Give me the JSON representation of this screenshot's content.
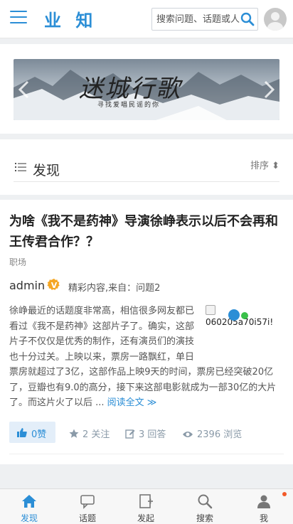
{
  "header": {
    "logo": "业 知",
    "search_placeholder": "搜索问题、话题或人"
  },
  "banner": {
    "title": "迷城行歌",
    "subtitle": "寻找爱唱民谣的你"
  },
  "section": {
    "title": "发现",
    "sort_label": "排序 ⬍"
  },
  "question": {
    "title": "为啥《我不是药神》导演徐峥表示以后不会再和王传君合作？？",
    "topic": "职场",
    "author": "admin",
    "meta": "精彩内容,来自：问题2",
    "thumb_alt": "060205a70i57i!",
    "excerpt": "徐峥最近的话题度非常高，相信很多网友都已看过《我不是药神》这部片子了。确实，这部片子不仅仅是优秀的制作，还有演员们的演技也十分过关。上映以来，票房一路飘红，单日票房就超过了3亿，这部作品上映9天的时间，票房已经突破20亿了，豆瓣也有9.0的高分，接下来这部电影就成为一部30亿的大片了。而这片火了以后 ...",
    "read_more": "阅读全文 ≫",
    "likes": "0赞",
    "follows": "2 关注",
    "answers": "3 回答",
    "views": "2396 浏览"
  },
  "nav": {
    "items": [
      {
        "label": "发现",
        "icon": "home-icon"
      },
      {
        "label": "话题",
        "icon": "chat-icon"
      },
      {
        "label": "发起",
        "icon": "compose-icon"
      },
      {
        "label": "搜索",
        "icon": "search-icon"
      },
      {
        "label": "我",
        "icon": "user-icon"
      }
    ]
  },
  "colors": {
    "accent": "#2b8ed6",
    "badge": "#f5a623",
    "notification": "#f25a29"
  }
}
